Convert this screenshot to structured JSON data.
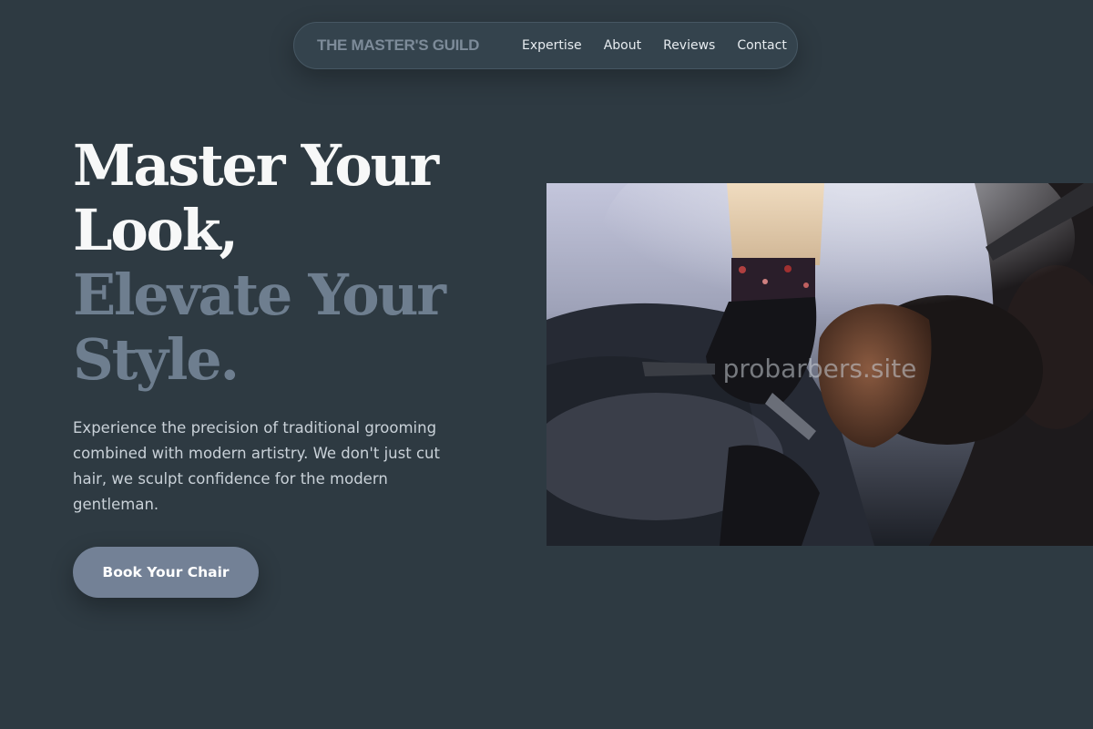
{
  "nav": {
    "brand": "THE MASTER'S GUILD",
    "links": [
      {
        "label": "Expertise"
      },
      {
        "label": "About"
      },
      {
        "label": "Reviews"
      },
      {
        "label": "Contact"
      }
    ]
  },
  "hero": {
    "headline": {
      "line1": "Master Your",
      "line2": "Look,",
      "line3": "Elevate Your",
      "line4": "Style."
    },
    "description": "Experience the precision of traditional grooming combined with modern artistry. We don't just cut hair, we sculpt confidence for the modern gentleman.",
    "cta_label": "Book Your Chair"
  },
  "image": {
    "watermark": "probarbers.site",
    "subject": "barber shaving client with straight razor"
  },
  "colors": {
    "background": "#2e3a42",
    "nav_background": "#34434d",
    "headline_light": "#f7f8f8",
    "headline_muted": "#6e7e8f",
    "body_text": "#c9d1d8",
    "cta_background": "#738196"
  }
}
